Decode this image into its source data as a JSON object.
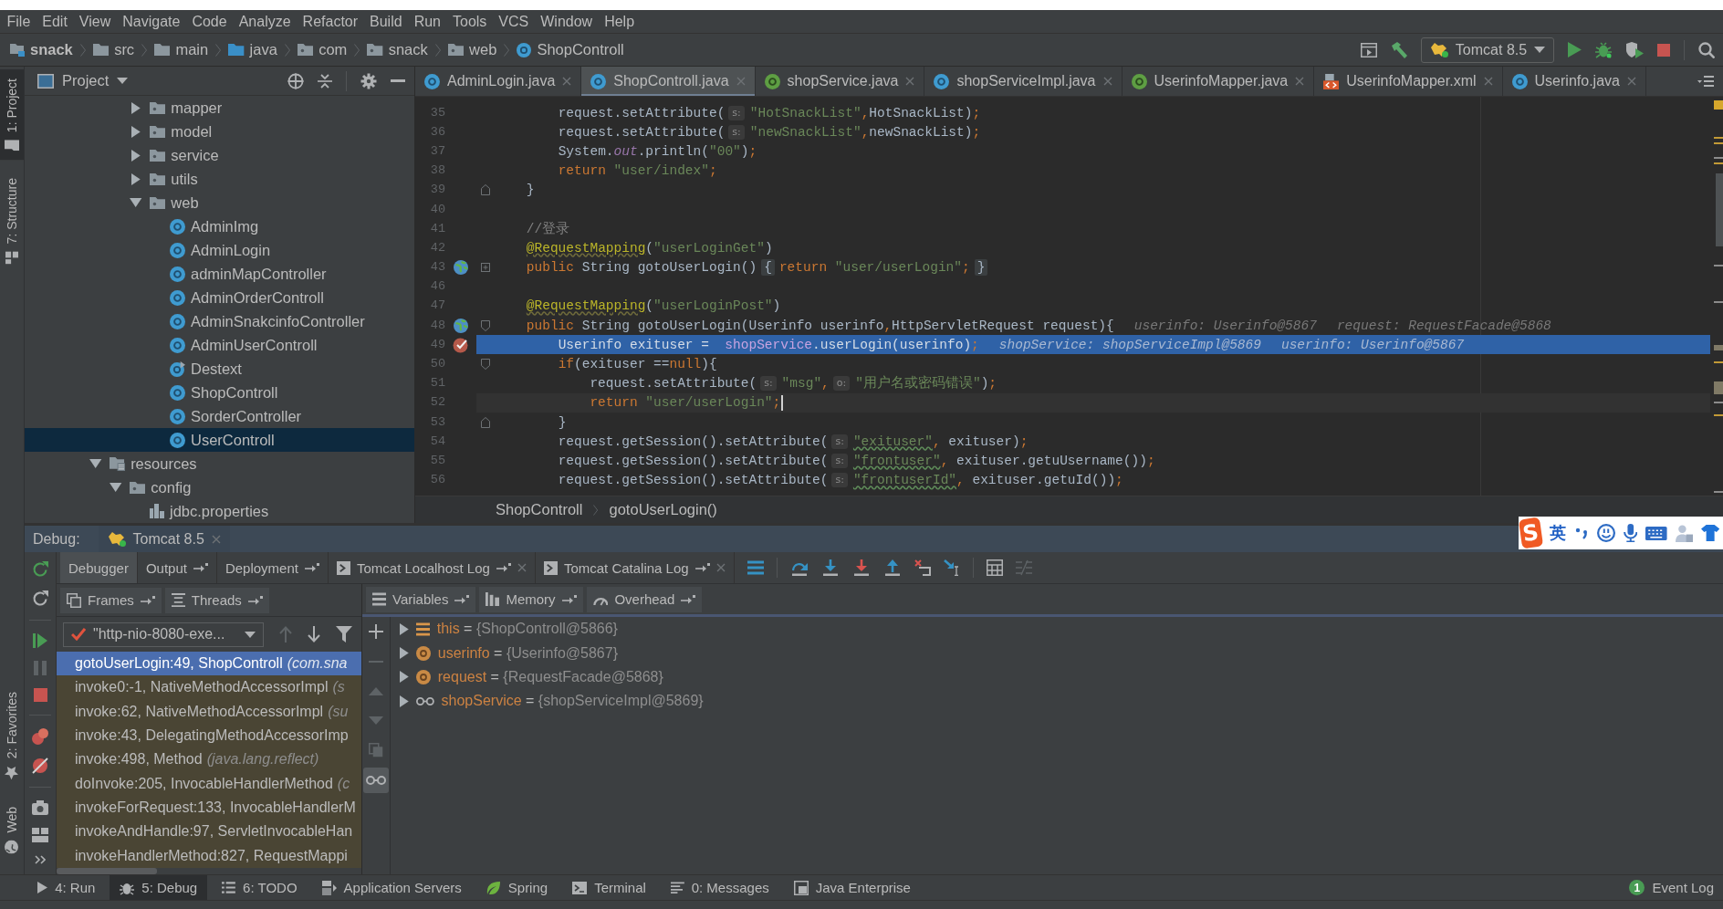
{
  "menu": [
    "File",
    "Edit",
    "View",
    "Navigate",
    "Code",
    "Analyze",
    "Refactor",
    "Build",
    "Run",
    "Tools",
    "VCS",
    "Window",
    "Help"
  ],
  "navbar": {
    "crumbs": [
      {
        "label": "snack",
        "kind": "module"
      },
      {
        "label": "src",
        "kind": "folder"
      },
      {
        "label": "main",
        "kind": "folder"
      },
      {
        "label": "java",
        "kind": "source"
      },
      {
        "label": "com",
        "kind": "package"
      },
      {
        "label": "snack",
        "kind": "package"
      },
      {
        "label": "web",
        "kind": "package"
      },
      {
        "label": "ShopControll",
        "kind": "class"
      }
    ],
    "run_config": "Tomcat 8.5"
  },
  "side_strip": {
    "top": [
      {
        "label": "1: Project",
        "kind": "project",
        "selected": true
      },
      {
        "label": "7: Structure",
        "kind": "structure",
        "selected": false
      }
    ],
    "bottom": [
      {
        "label": "2: Favorites",
        "kind": "favorites",
        "selected": false
      },
      {
        "label": "Web",
        "kind": "web",
        "selected": false
      }
    ]
  },
  "project": {
    "title": "Project",
    "tree": [
      {
        "kind": "scrolled",
        "children": [
          {
            "kind": "scrolled",
            "children": [
              {
                "label": "mapper",
                "kind": "package",
                "expanded": false,
                "selected": false
              },
              {
                "label": "model",
                "kind": "package",
                "expanded": false,
                "selected": false
              },
              {
                "label": "service",
                "kind": "package",
                "expanded": false,
                "selected": false
              },
              {
                "label": "utils",
                "kind": "package",
                "expanded": false,
                "selected": false
              },
              {
                "label": "web",
                "kind": "package",
                "expanded": true,
                "selected": false,
                "children": [
                  {
                    "label": "AdminImg",
                    "kind": "class",
                    "selected": false
                  },
                  {
                    "label": "AdminLogin",
                    "kind": "class",
                    "selected": false
                  },
                  {
                    "label": "adminMapController",
                    "kind": "class",
                    "selected": false
                  },
                  {
                    "label": "AdminOrderControll",
                    "kind": "class",
                    "selected": false
                  },
                  {
                    "label": "AdminSnakcinfoController",
                    "kind": "class",
                    "selected": false
                  },
                  {
                    "label": "AdminUserControll",
                    "kind": "class",
                    "selected": false
                  },
                  {
                    "label": "Destext",
                    "kind": "runnable",
                    "selected": false
                  },
                  {
                    "label": "ShopControll",
                    "kind": "class",
                    "selected": false
                  },
                  {
                    "label": "SorderController",
                    "kind": "class",
                    "selected": false
                  },
                  {
                    "label": "UserControll",
                    "kind": "class",
                    "selected": true
                  }
                ]
              }
            ]
          }
        ]
      },
      {
        "label": "resources",
        "kind": "resources",
        "expanded": true,
        "selected": false,
        "children": [
          {
            "label": "config",
            "kind": "package",
            "expanded": true,
            "selected": false,
            "children": [
              {
                "label": "jdbc.properties",
                "kind": "properties",
                "selected": false
              }
            ]
          }
        ]
      }
    ]
  },
  "editor": {
    "tabs": [
      {
        "label": "AdminLogin.java",
        "kind": "class",
        "selected": false
      },
      {
        "label": "ShopControll.java",
        "kind": "class",
        "selected": true
      },
      {
        "label": "shopService.java",
        "kind": "interface",
        "selected": false
      },
      {
        "label": "shopServiceImpl.java",
        "kind": "class",
        "selected": false
      },
      {
        "label": "UserinfoMapper.java",
        "kind": "interface",
        "selected": false
      },
      {
        "label": "UserinfoMapper.xml",
        "kind": "xml",
        "selected": false
      },
      {
        "label": "Userinfo.java",
        "kind": "class",
        "selected": false
      }
    ],
    "lines": [
      {
        "number": "35",
        "kind": "plain",
        "parts": [
          {
            "kind": "code",
            "tokens": [
              {
                "kind": "plain",
                "text": "        request.setAttribute("
              }
            ]
          },
          {
            "kind": "param",
            "text": "s:"
          },
          {
            "kind": "code",
            "tokens": [
              {
                "kind": "string",
                "text": "\"HotSnackList\""
              },
              {
                "kind": "keyword",
                "text": ","
              },
              {
                "kind": "plain",
                "text": "HotSnackList)"
              },
              {
                "kind": "keyword",
                "text": ";"
              }
            ]
          }
        ]
      },
      {
        "number": "36",
        "kind": "plain",
        "parts": [
          {
            "kind": "code",
            "tokens": [
              {
                "kind": "plain",
                "text": "        request.setAttribute("
              }
            ]
          },
          {
            "kind": "param",
            "text": "s:"
          },
          {
            "kind": "code",
            "tokens": [
              {
                "kind": "string",
                "text": "\"newSnackList\""
              },
              {
                "kind": "keyword",
                "text": ","
              },
              {
                "kind": "plain",
                "text": "newSnackList)"
              },
              {
                "kind": "keyword",
                "text": ";"
              }
            ]
          }
        ]
      },
      {
        "number": "37",
        "kind": "plain",
        "parts": [
          {
            "kind": "code",
            "tokens": [
              {
                "kind": "plain",
                "text": "        System."
              },
              {
                "kind": "static",
                "text": "out"
              },
              {
                "kind": "plain",
                "text": ".println("
              },
              {
                "kind": "string",
                "text": "\"00\""
              },
              {
                "kind": "plain",
                "text": ")"
              },
              {
                "kind": "keyword",
                "text": ";"
              }
            ]
          }
        ]
      },
      {
        "number": "38",
        "kind": "plain",
        "parts": [
          {
            "kind": "code",
            "tokens": [
              {
                "kind": "keyword",
                "text": "        return "
              },
              {
                "kind": "string",
                "text": "\"user/index\""
              },
              {
                "kind": "keyword",
                "text": ";"
              }
            ]
          }
        ]
      },
      {
        "number": "39",
        "kind": "plain",
        "fold": {
          "kind": "close"
        },
        "parts": [
          {
            "kind": "code",
            "tokens": [
              {
                "kind": "plain",
                "text": "    }"
              }
            ]
          }
        ]
      },
      {
        "number": "40",
        "kind": "plain"
      },
      {
        "number": "41",
        "kind": "plain",
        "parts": [
          {
            "kind": "code",
            "tokens": [
              {
                "kind": "comment",
                "text": "    //登录"
              }
            ]
          }
        ]
      },
      {
        "number": "42",
        "kind": "plain",
        "parts": [
          {
            "kind": "code",
            "tokens": [
              {
                "kind": "annotation",
                "text": "    @RequestMapping"
              },
              {
                "kind": "plain",
                "text": "("
              },
              {
                "kind": "string",
                "text": "\"userLoginGet\""
              },
              {
                "kind": "plain",
                "text": ")"
              }
            ]
          }
        ]
      },
      {
        "number": "43",
        "kind": "plain",
        "gutter": {
          "kind": "mapping"
        },
        "fold": {
          "kind": "collapsed"
        },
        "parts": [
          {
            "kind": "code",
            "tokens": [
              {
                "kind": "keyword",
                "text": "    public "
              },
              {
                "kind": "plain",
                "text": "String gotoUserLogin()"
              }
            ]
          },
          {
            "kind": "fold",
            "text": "{"
          },
          {
            "kind": "code",
            "tokens": [
              {
                "kind": "keyword",
                "text": "return "
              },
              {
                "kind": "string",
                "text": "\"user/userLogin\""
              },
              {
                "kind": "keyword",
                "text": ";"
              }
            ]
          },
          {
            "kind": "fold",
            "text": "}"
          }
        ]
      },
      {
        "number": "46",
        "kind": "plain"
      },
      {
        "number": "47",
        "kind": "plain",
        "parts": [
          {
            "kind": "code",
            "tokens": [
              {
                "kind": "annotation",
                "text": "    @RequestMapping"
              },
              {
                "kind": "plain",
                "text": "("
              },
              {
                "kind": "string",
                "text": "\"userLoginPost\""
              },
              {
                "kind": "plain",
                "text": ")"
              }
            ]
          }
        ]
      },
      {
        "number": "48",
        "kind": "plain",
        "gutter": {
          "kind": "mapping"
        },
        "fold": {
          "kind": "open"
        },
        "parts": [
          {
            "kind": "code",
            "tokens": [
              {
                "kind": "keyword",
                "text": "    public "
              },
              {
                "kind": "plain",
                "text": "String gotoUserLogin(Userinfo userinfo"
              },
              {
                "kind": "keyword",
                "text": ","
              },
              {
                "kind": "plain",
                "text": "HttpServletRequest request){"
              }
            ]
          },
          {
            "kind": "hint",
            "text": "userinfo: Userinfo@5867"
          },
          {
            "kind": "hint",
            "text": "request: RequestFacade@5868"
          }
        ]
      },
      {
        "number": "49",
        "kind": "execution",
        "gutter": {
          "kind": "breakpoint"
        },
        "parts": [
          {
            "kind": "code",
            "tokens": [
              {
                "kind": "plain",
                "text": "        Userinfo exituser =  "
              },
              {
                "kind": "field",
                "text": "shopService"
              },
              {
                "kind": "plain",
                "text": ".userLogin(userinfo)"
              },
              {
                "kind": "keyword",
                "text": ";"
              }
            ]
          },
          {
            "kind": "hint",
            "text": "shopService: shopServiceImpl@5869"
          },
          {
            "kind": "hint",
            "text": "userinfo: Userinfo@5867"
          }
        ]
      },
      {
        "number": "50",
        "kind": "plain",
        "fold": {
          "kind": "open"
        },
        "parts": [
          {
            "kind": "code",
            "tokens": [
              {
                "kind": "keyword",
                "text": "        if"
              },
              {
                "kind": "plain",
                "text": "(exituser =="
              },
              {
                "kind": "keyword",
                "text": "null"
              },
              {
                "kind": "plain",
                "text": "){"
              }
            ]
          }
        ]
      },
      {
        "number": "51",
        "kind": "plain",
        "parts": [
          {
            "kind": "code",
            "tokens": [
              {
                "kind": "plain",
                "text": "            request.setAttribute("
              }
            ]
          },
          {
            "kind": "param",
            "text": "s:"
          },
          {
            "kind": "code",
            "tokens": [
              {
                "kind": "string",
                "text": "\"msg\""
              },
              {
                "kind": "keyword",
                "text": ","
              }
            ]
          },
          {
            "kind": "param",
            "text": "o:"
          },
          {
            "kind": "code",
            "tokens": [
              {
                "kind": "string",
                "text": "\"用户名或密码错误\""
              },
              {
                "kind": "plain",
                "text": ")"
              },
              {
                "kind": "keyword",
                "text": ";"
              }
            ]
          }
        ]
      },
      {
        "number": "52",
        "kind": "caret",
        "parts": [
          {
            "kind": "code",
            "tokens": [
              {
                "kind": "keyword",
                "text": "            return "
              },
              {
                "kind": "string",
                "text": "\"user/userLogin\""
              },
              {
                "kind": "keyword",
                "text": ";"
              }
            ]
          }
        ]
      },
      {
        "number": "53",
        "kind": "plain",
        "fold": {
          "kind": "close"
        },
        "parts": [
          {
            "kind": "code",
            "tokens": [
              {
                "kind": "plain",
                "text": "        }"
              }
            ]
          }
        ]
      },
      {
        "number": "54",
        "kind": "plain",
        "parts": [
          {
            "kind": "code",
            "tokens": [
              {
                "kind": "plain",
                "text": "        request.getSession().setAttribute("
              }
            ]
          },
          {
            "kind": "param",
            "text": "s:"
          },
          {
            "kind": "code",
            "tokens": [
              {
                "kind": "typo",
                "text": "\"exituser\""
              },
              {
                "kind": "keyword",
                "text": ","
              },
              {
                "kind": "plain",
                "text": " exituser)"
              },
              {
                "kind": "keyword",
                "text": ";"
              }
            ]
          }
        ]
      },
      {
        "number": "55",
        "kind": "plain",
        "parts": [
          {
            "kind": "code",
            "tokens": [
              {
                "kind": "plain",
                "text": "        request.getSession().setAttribute("
              }
            ]
          },
          {
            "kind": "param",
            "text": "s:"
          },
          {
            "kind": "code",
            "tokens": [
              {
                "kind": "typo",
                "text": "\"frontuser\""
              },
              {
                "kind": "keyword",
                "text": ","
              },
              {
                "kind": "plain",
                "text": " exituser.getuUsername())"
              },
              {
                "kind": "keyword",
                "text": ";"
              }
            ]
          }
        ]
      },
      {
        "number": "56",
        "kind": "plain",
        "parts": [
          {
            "kind": "code",
            "tokens": [
              {
                "kind": "plain",
                "text": "        request.getSession().setAttribute("
              }
            ]
          },
          {
            "kind": "param",
            "text": "s:"
          },
          {
            "kind": "code",
            "tokens": [
              {
                "kind": "typo",
                "text": "\"frontuserId\""
              },
              {
                "kind": "keyword",
                "text": ","
              },
              {
                "kind": "plain",
                "text": " exituser.getuId())"
              },
              {
                "kind": "keyword",
                "text": ";"
              }
            ]
          }
        ]
      }
    ],
    "breadcrumb": [
      "ShopControll",
      "gotoUserLogin()"
    ]
  },
  "debug": {
    "title": "Debug:",
    "sessions": [
      {
        "label": "Tomcat 8.5"
      }
    ],
    "tabs": [
      {
        "label": "Debugger",
        "kind": "view",
        "selected": true,
        "pinned": false,
        "closable": false
      },
      {
        "label": "Output",
        "kind": "view",
        "selected": false,
        "pinned": true,
        "closable": false
      },
      {
        "label": "Deployment",
        "kind": "view",
        "selected": false,
        "pinned": true,
        "closable": false
      },
      {
        "label": "Tomcat Localhost Log",
        "kind": "log",
        "selected": false,
        "pinned": true,
        "closable": true
      },
      {
        "label": "Tomcat Catalina Log",
        "kind": "log",
        "selected": false,
        "pinned": true,
        "closable": true
      }
    ],
    "frame_tabs": [
      {
        "label": "Frames",
        "kind": "frames"
      },
      {
        "label": "Threads",
        "kind": "threads"
      }
    ],
    "variable_tabs": [
      {
        "label": "Variables",
        "kind": "variables"
      },
      {
        "label": "Memory",
        "kind": "memory"
      },
      {
        "label": "Overhead",
        "kind": "overhead"
      }
    ],
    "thread": "\"http-nio-8080-exe...",
    "frames": [
      {
        "method": "gotoUserLogin:49, ShopControll",
        "location": "(com.sna",
        "kind": "project",
        "selected": true
      },
      {
        "method": "invoke0:-1, NativeMethodAccessorImpl",
        "location": "(s",
        "kind": "library",
        "selected": false
      },
      {
        "method": "invoke:62, NativeMethodAccessorImpl",
        "location": "(su",
        "kind": "library",
        "selected": false
      },
      {
        "method": "invoke:43, DelegatingMethodAccessorImp",
        "kind": "library",
        "selected": false
      },
      {
        "method": "invoke:498, Method",
        "location": "(java.lang.reflect)",
        "kind": "library",
        "selected": false
      },
      {
        "method": "doInvoke:205, InvocableHandlerMethod",
        "location": "(c",
        "kind": "library",
        "selected": false
      },
      {
        "method": "invokeForRequest:133, InvocableHandlerM",
        "kind": "library",
        "selected": false
      },
      {
        "method": "invokeAndHandle:97, ServletInvocableHan",
        "kind": "library",
        "selected": false
      },
      {
        "method": "invokeHandlerMethod:827, RequestMappi",
        "kind": "library",
        "selected": false
      }
    ],
    "variables": [
      {
        "name": "this",
        "separator": "=",
        "value": "{ShopControll@5866}",
        "kind": "this",
        "expanded": false
      },
      {
        "name": "userinfo",
        "separator": "=",
        "value": "{Userinfo@5867}",
        "kind": "param",
        "expanded": false
      },
      {
        "name": "request",
        "separator": "=",
        "value": "{RequestFacade@5868}",
        "kind": "param",
        "expanded": false
      },
      {
        "name": "shopService",
        "separator": "=",
        "value": "{shopServiceImpl@5869}",
        "kind": "field",
        "expanded": false
      }
    ]
  },
  "tool_windows": {
    "items": [
      {
        "label": "4: Run",
        "kind": "run",
        "selected": false
      },
      {
        "label": "5: Debug",
        "kind": "debug",
        "selected": true
      },
      {
        "label": "6: TODO",
        "kind": "todo",
        "selected": false
      },
      {
        "label": "Application Servers",
        "kind": "servers",
        "selected": false
      },
      {
        "label": "Spring",
        "kind": "spring",
        "selected": false
      },
      {
        "label": "Terminal",
        "kind": "terminal",
        "selected": false
      },
      {
        "label": "0: Messages",
        "kind": "messages",
        "selected": false
      },
      {
        "label": "Java Enterprise",
        "kind": "enterprise",
        "selected": false
      }
    ],
    "event_log": {
      "label": "Event Log",
      "badge": "1"
    }
  },
  "ime": {
    "logo": "S",
    "mode": "英"
  }
}
